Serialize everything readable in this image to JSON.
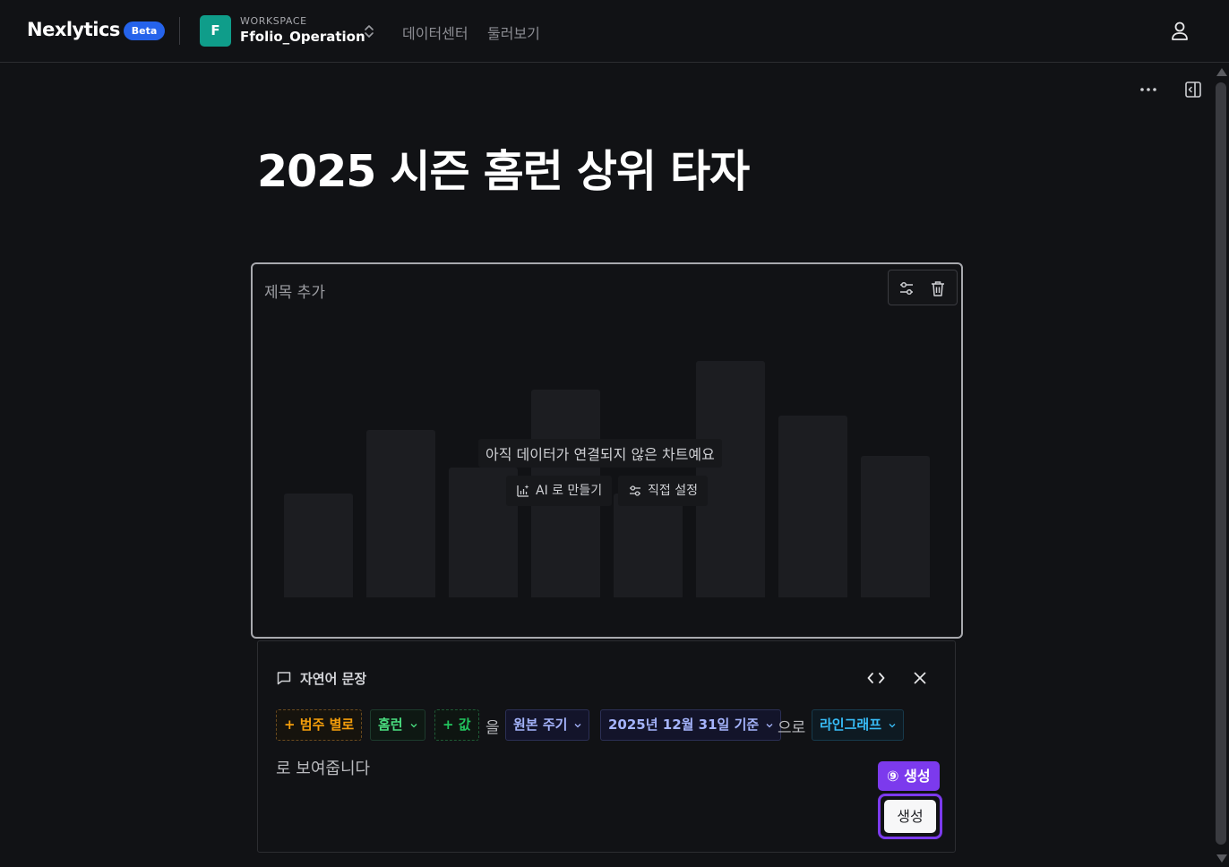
{
  "header": {
    "logo": "Nexlytics",
    "beta_badge": "Beta",
    "workspace": {
      "avatar_letter": "F",
      "caption": "WORKSPACE",
      "name": "Ffolio_Operation"
    },
    "nav": [
      "데이터센터",
      "둘러보기"
    ]
  },
  "page": {
    "title": "2025 시즌 홈런 상위 타자"
  },
  "chart_card": {
    "title_placeholder": "제목 추가",
    "empty_message": "아직 데이터가 연결되지 않은 차트예요",
    "ai_button": "AI 로 만들기",
    "manual_button": "직접 설정",
    "placeholder_bar_levels": [
      0.44,
      0.71,
      0.55,
      0.88,
      0.44,
      1.0,
      0.77,
      0.6
    ]
  },
  "nl_panel": {
    "title": "자연어 문장",
    "tokens": {
      "category": "+ 범주 별로",
      "category_value": "홈런",
      "add_value": "+ 값",
      "particle_1": "을",
      "period": "원본 주기",
      "date": "2025년 12월 31일 기준",
      "particle_2": "으로",
      "chart_type": "라인그래프"
    },
    "line2": "로 보여줍니다",
    "generate_badge": "⑨ 생성",
    "generate_button": "생성"
  },
  "colors": {
    "background": "#111215",
    "beta": "#2563eb",
    "workspace_avatar": "#0f9d8a",
    "accent_purple": "#7c3aed",
    "category": "#f59e0b",
    "value": "#22c55e",
    "period": "#a5b4fc",
    "chart_type": "#38bdf8"
  }
}
